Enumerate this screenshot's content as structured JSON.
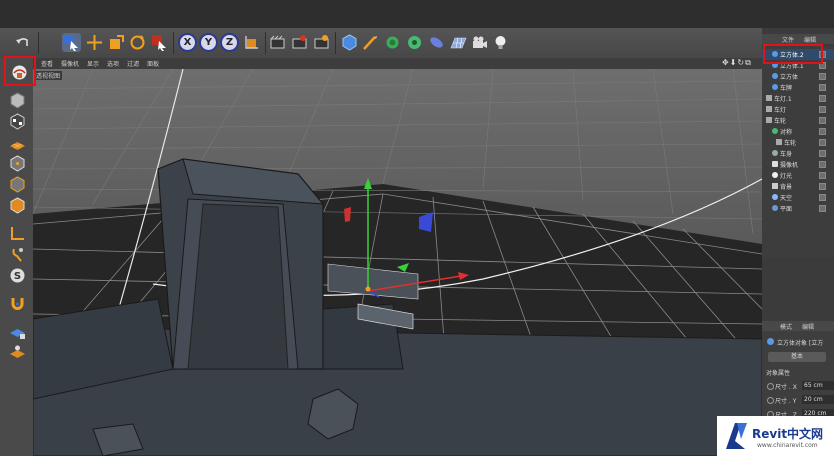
{
  "toolbar": {
    "undo_icon": "undo-icon",
    "axis_x": "X",
    "axis_y": "Y",
    "axis_z": "Z",
    "colors": {
      "accent_blue": "#4a7fd6",
      "highlight_red": "#e0121a",
      "axis_badge": "#2c3a8f"
    }
  },
  "viewport": {
    "menu": [
      "查看",
      "摄像机",
      "显示",
      "选项",
      "过滤",
      "面板"
    ],
    "label": "透视视图",
    "nav_icons": "✥⬇↻⧉"
  },
  "object_manager": {
    "menu": [
      "文件",
      "编辑"
    ],
    "items": [
      {
        "label": "立方体.2",
        "selected": true
      },
      {
        "label": "立方体.1"
      },
      {
        "label": "立方体"
      },
      {
        "label": "车牌"
      },
      {
        "label": "车灯.1"
      },
      {
        "label": "车灯"
      },
      {
        "label": "车轮"
      },
      {
        "label": "对称"
      },
      {
        "label": "车轮"
      },
      {
        "label": "车身"
      },
      {
        "label": "摄像机"
      },
      {
        "label": "灯光"
      },
      {
        "label": "背景"
      },
      {
        "label": "天空"
      },
      {
        "label": "平面"
      }
    ]
  },
  "attributes": {
    "menu": [
      "模式",
      "编辑"
    ],
    "object_title": "立方体对象 [立方",
    "tab_basic": "基本",
    "section": "对象属性",
    "size_x_label": "尺寸 . X",
    "size_x_value": "65 cm",
    "size_y_label": "尺寸 . Y",
    "size_y_value": "20 cm",
    "size_z_label": "尺寸 . Z",
    "size_z_value": "220 cm"
  },
  "watermark": {
    "brand": "Revit中文网",
    "site": "www.chinarevit.com"
  }
}
